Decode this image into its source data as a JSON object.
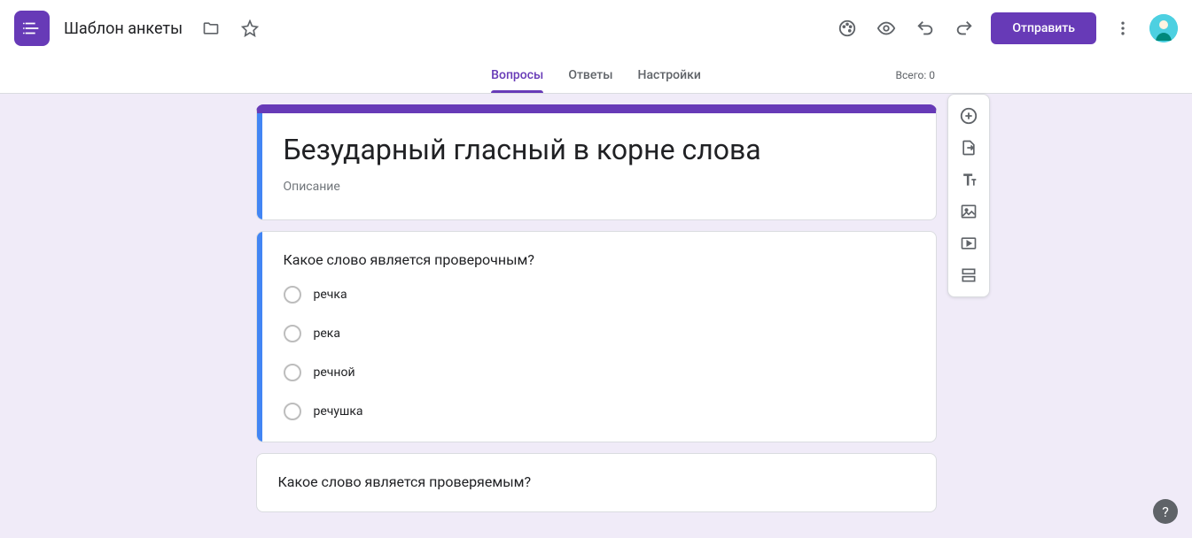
{
  "header": {
    "doc_title": "Шаблон анкеты",
    "send_label": "Отправить"
  },
  "tabs": {
    "questions": "Вопросы",
    "answers": "Ответы",
    "settings": "Настройки",
    "total": "Всего: 0"
  },
  "form": {
    "title": "Безударный гласный в корне слова",
    "desc_placeholder": "Описание"
  },
  "q1": {
    "text": "Какое слово является проверочным?",
    "opts": [
      "речка",
      "река",
      "речной",
      "речушка"
    ]
  },
  "q2": {
    "text": "Какое слово является проверяемым?"
  }
}
